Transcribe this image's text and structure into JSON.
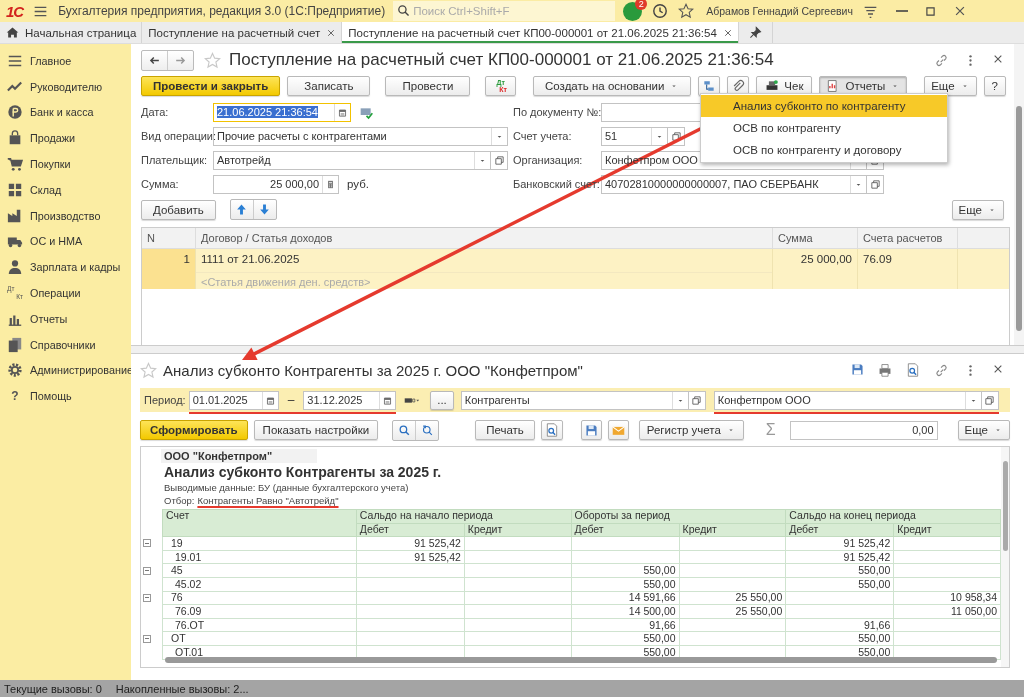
{
  "window": {
    "logo": "1С",
    "title": "Бухгалтерия предприятия, редакция 3.0  (1С:Предприятие)",
    "search": {
      "placeholder": "Поиск Ctrl+Shift+F"
    },
    "notifications": "2",
    "user": "Абрамов Геннадий Сергеевич"
  },
  "tabs": [
    {
      "label": "Начальная страница",
      "kind": "home",
      "selected": false
    },
    {
      "label": "Поступление на расчетный счет",
      "kind": "doc",
      "selected": false
    },
    {
      "label": "Поступление на расчетный счет КП00-000001 от 21.06.2025 21:36:54",
      "kind": "doc",
      "selected": true
    }
  ],
  "sidebar": {
    "items": [
      {
        "label": "Главное"
      },
      {
        "label": "Руководителю"
      },
      {
        "label": "Банк и касса"
      },
      {
        "label": "Продажи"
      },
      {
        "label": "Покупки"
      },
      {
        "label": "Склад"
      },
      {
        "label": "Производство"
      },
      {
        "label": "ОС и НМА"
      },
      {
        "label": "Зарплата и кадры"
      },
      {
        "label": "Операции",
        "icon_top": "Дт",
        "icon_bottom": "Кт"
      },
      {
        "label": "Отчеты"
      },
      {
        "label": "Справочники"
      },
      {
        "label": "Администрирование"
      },
      {
        "label": "Помощь",
        "glyph": "?"
      }
    ]
  },
  "document": {
    "title": "Поступление на расчетный счет КП00-000001 от 21.06.2025 21:36:54",
    "toolbar": [
      {
        "kind": "primary",
        "label": "Провести и закрыть"
      },
      {
        "kind": "button",
        "label": "Записать"
      },
      {
        "kind": "button",
        "label": "Провести"
      },
      {
        "kind": "dtkt",
        "top": "Дт",
        "bottom": "Кт"
      },
      {
        "kind": "dropdown",
        "label": "Создать на основании"
      },
      {
        "kind": "structure"
      },
      {
        "kind": "attach"
      },
      {
        "kind": "receipt",
        "label": "Чек"
      },
      {
        "kind": "menu",
        "label": "Отчеты",
        "expanded": true,
        "items": [
          {
            "label": "Анализ субконто по контрагенту",
            "selected": true
          },
          {
            "label": "ОСВ по контрагенту",
            "selected": false
          },
          {
            "label": "ОСВ по контрагенту и договору",
            "selected": false
          }
        ]
      }
    ],
    "more": "Еще",
    "help": "?",
    "fields_left": [
      {
        "label": "Дата:",
        "value": "21.06.2025 21:36:54",
        "kind": "date",
        "focused": true
      },
      {
        "label": "Вид операции:",
        "value": "Прочие расчеты с контрагентами",
        "kind": "select"
      },
      {
        "label": "Плательщик:",
        "value": "Автотрейд",
        "kind": "ref"
      },
      {
        "label": "Сумма:",
        "value": "25 000,00",
        "kind": "number",
        "unit": "руб."
      }
    ],
    "fields_right": [
      {
        "label": "По документу №:",
        "kind": "text"
      },
      {
        "label": "Счет учета:",
        "value": "51",
        "kind": "ref-short"
      },
      {
        "label": "Организация:",
        "value": "Конфетпром ООО",
        "kind": "ref"
      },
      {
        "label": "Банковский счет:",
        "value": "40702810000000000007, ПАО СБЕРБАНК",
        "kind": "ref"
      }
    ],
    "table": {
      "add": "Добавить",
      "more": "Еще",
      "columns": [
        "N",
        "Договор / Статья доходов",
        "Сумма",
        "Счета расчетов"
      ],
      "rows": [
        {
          "n": "1",
          "contract": "1111 от 21.06.2025",
          "article_placeholder": "<Статья движения ден. средств>",
          "sum": "25 000,00",
          "accounts": "76.09",
          "selected": true
        }
      ]
    }
  },
  "report": {
    "title": "Анализ субконто Контрагенты за 2025 г. ООО \"Конфетпром\"",
    "period": {
      "label": "Период:",
      "from": "01.01.2025",
      "dash": "–",
      "to": "31.12.2025",
      "more": "...",
      "underlined": true
    },
    "subconto": {
      "value": "Контрагенты"
    },
    "organization": {
      "value": "Конфетпром ООО",
      "underlined": true
    },
    "toolbar": {
      "generate": "Сформировать",
      "settings": "Показать настройки",
      "print": "Печать",
      "register": "Регистр учета",
      "sigma": "Σ",
      "sum": "0,00",
      "more": "Еще"
    },
    "sheet": {
      "organization": "ООО \"Конфетпром\"",
      "title": "Анализ субконто Контрагенты за 2025 г.",
      "output": "Выводимые данные: БУ (данные бухгалтерского учета)",
      "filter_label": "Отбор:",
      "filter": {
        "text": "Контрагенты Равно \"Автотрейд\"",
        "underlined": true
      },
      "columns": {
        "account": "Счет",
        "groups": [
          {
            "label": "Сальдо на начало периода",
            "sub": [
              "Дебет",
              "Кредит"
            ]
          },
          {
            "label": "Обороты за период",
            "sub": [
              "Дебет",
              "Кредит"
            ]
          },
          {
            "label": "Сальдо на конец периода",
            "sub": [
              "Дебет",
              "Кредит"
            ]
          }
        ]
      },
      "rows": [
        {
          "account": "19",
          "expanded": true,
          "cells": [
            "91 525,42",
            null,
            null,
            null,
            "91 525,42",
            null
          ],
          "children": [
            {
              "account": "19.01",
              "cells": [
                "91 525,42",
                null,
                null,
                null,
                "91 525,42",
                null
              ]
            }
          ]
        },
        {
          "account": "45",
          "expanded": true,
          "cells": [
            null,
            null,
            "550,00",
            null,
            "550,00",
            null
          ],
          "children": [
            {
              "account": "45.02",
              "cells": [
                null,
                null,
                "550,00",
                null,
                "550,00",
                null
              ]
            }
          ]
        },
        {
          "account": "76",
          "expanded": true,
          "cells": [
            null,
            null,
            "14 591,66",
            "25 550,00",
            null,
            "10 958,34"
          ],
          "children": [
            {
              "account": "76.09",
              "cells": [
                null,
                null,
                "14 500,00",
                "25 550,00",
                null,
                "11 050,00"
              ]
            },
            {
              "account": "76.ОТ",
              "cells": [
                null,
                null,
                "91,66",
                null,
                "91,66",
                null
              ]
            }
          ]
        },
        {
          "account": "ОТ",
          "expanded": true,
          "cells": [
            null,
            null,
            "550,00",
            null,
            "550,00",
            null
          ],
          "children": [
            {
              "account": "ОТ.01",
              "cells": [
                null,
                null,
                "550,00",
                null,
                "550,00",
                null
              ]
            }
          ]
        }
      ]
    }
  },
  "status_bar": [
    "Текущие вызовы: 0",
    "Накопленные вызовы: 2..."
  ]
}
